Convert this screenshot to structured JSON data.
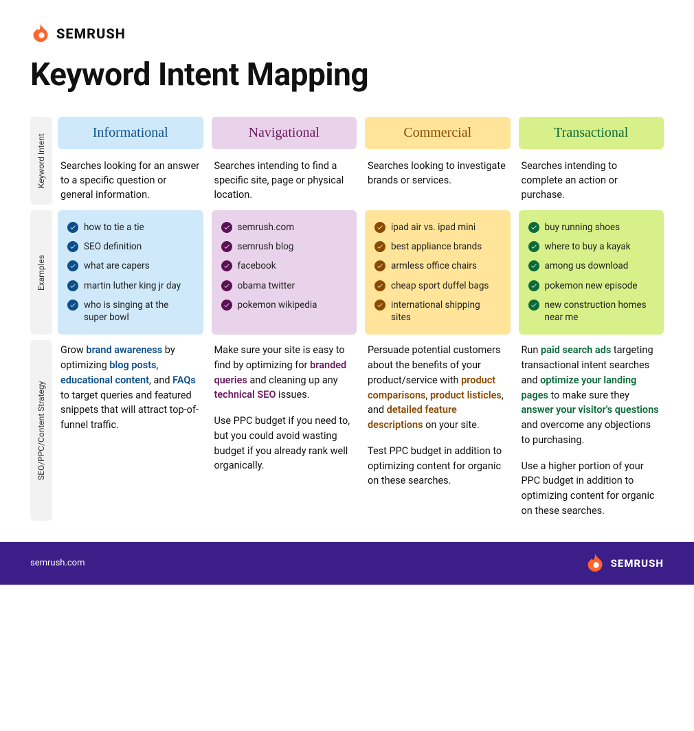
{
  "brand": {
    "name": "SEMRUSH",
    "site": "semrush.com"
  },
  "title": "Keyword Intent Mapping",
  "row_labels": {
    "intent": "Keyword Intent",
    "examples": "Examples",
    "strategy": "SEO/PPC/Content Strategy"
  },
  "columns": [
    {
      "key": "informational",
      "header": "Informational",
      "description": "Searches looking for an answer to a specific question or general information.",
      "examples": [
        "how to tie a tie",
        "SEO definition",
        "what are capers",
        "martin luther king jr day",
        "who is singing at the super bowl"
      ],
      "strategy": [
        [
          {
            "t": "Grow "
          },
          {
            "t": "brand awareness",
            "hl": true
          },
          {
            "t": " by optimizing "
          },
          {
            "t": "blog posts",
            "hl": true
          },
          {
            "t": ", "
          },
          {
            "t": "educational content",
            "hl": true
          },
          {
            "t": ", and "
          },
          {
            "t": "FAQs",
            "hl": true
          },
          {
            "t": " to target queries and featured snippets that will attract top-of-funnel traffic."
          }
        ]
      ]
    },
    {
      "key": "navigational",
      "header": "Navigational",
      "description": "Searches intending to find a specific site, page or physical location.",
      "examples": [
        "semrush.com",
        "semrush blog",
        "facebook",
        "obama twitter",
        "pokemon wikipedia"
      ],
      "strategy": [
        [
          {
            "t": "Make sure your site is easy to find by optimizing for "
          },
          {
            "t": "branded queries",
            "hl": true
          },
          {
            "t": " and cleaning up any "
          },
          {
            "t": "technical SEO",
            "hl": true
          },
          {
            "t": " issues."
          }
        ],
        [
          {
            "t": "Use PPC budget if you need to, but you could avoid wasting budget if you already rank well organically."
          }
        ]
      ]
    },
    {
      "key": "commercial",
      "header": "Commercial",
      "description": "Searches looking to investigate brands or services.",
      "examples": [
        "ipad air vs. ipad mini",
        "best appliance brands",
        "armless office chairs",
        "cheap sport duffel bags",
        "international shipping sites"
      ],
      "strategy": [
        [
          {
            "t": "Persuade potential customers about the benefits of your product/service with "
          },
          {
            "t": "product comparisons",
            "hl": true
          },
          {
            "t": ", "
          },
          {
            "t": "product listicles",
            "hl": true
          },
          {
            "t": ", and "
          },
          {
            "t": "detailed feature descriptions",
            "hl": true
          },
          {
            "t": " on your site."
          }
        ],
        [
          {
            "t": "Test PPC budget in addition to optimizing content for organic on these searches."
          }
        ]
      ]
    },
    {
      "key": "transactional",
      "header": "Transactional",
      "description": "Searches intending to complete an action or purchase.",
      "examples": [
        "buy running shoes",
        "where to buy a kayak",
        "among us download",
        "pokemon new episode",
        "new construction homes near me"
      ],
      "strategy": [
        [
          {
            "t": "Run "
          },
          {
            "t": "paid search ads",
            "hl": true
          },
          {
            "t": " targeting transactional intent searches and "
          },
          {
            "t": "optimize your landing pages",
            "hl": true
          },
          {
            "t": " to make sure they "
          },
          {
            "t": "answer your visitor's questions",
            "hl": true
          },
          {
            "t": " and overcome any objections to purchasing."
          }
        ],
        [
          {
            "t": "Use a higher portion of your PPC budget in addition to optimizing content for organic on these searches."
          }
        ]
      ]
    }
  ]
}
